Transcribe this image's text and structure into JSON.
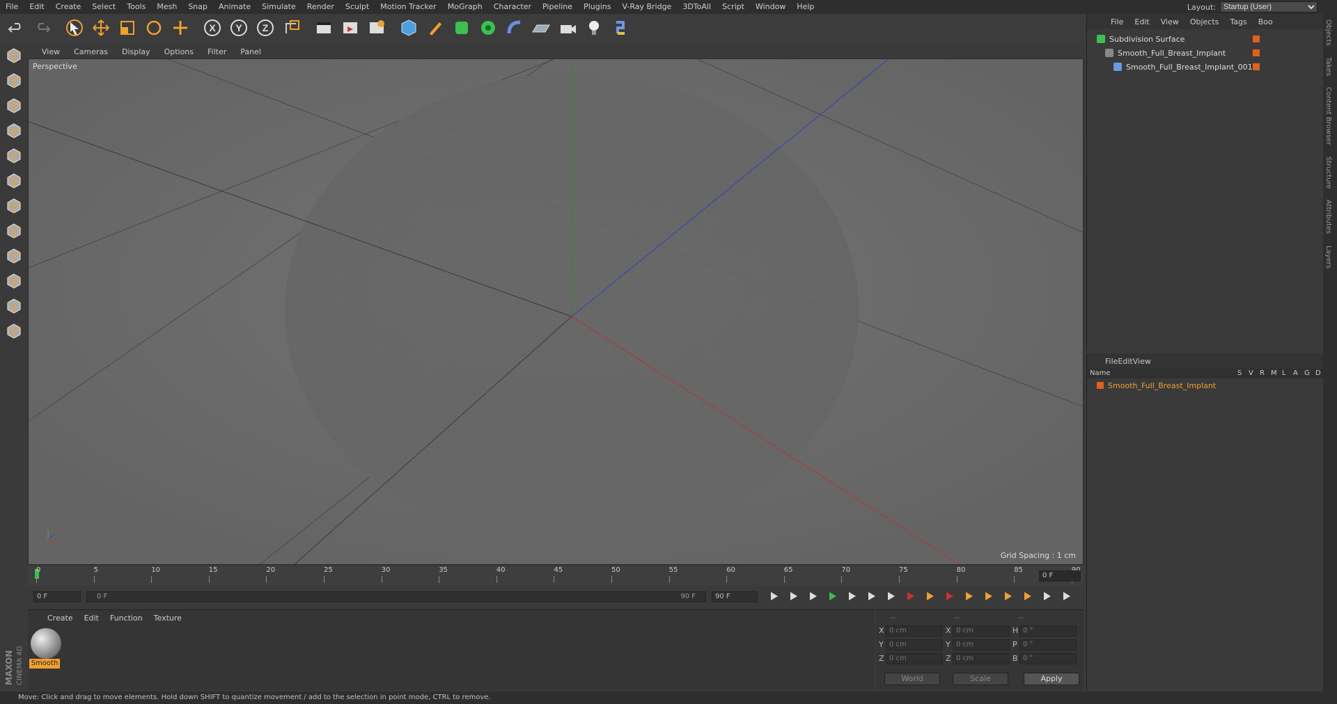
{
  "menu": [
    "File",
    "Edit",
    "Create",
    "Select",
    "Tools",
    "Mesh",
    "Snap",
    "Animate",
    "Simulate",
    "Render",
    "Sculpt",
    "Motion Tracker",
    "MoGraph",
    "Character",
    "Pipeline",
    "Plugins",
    "V-Ray Bridge",
    "3DToAll",
    "Script",
    "Window",
    "Help"
  ],
  "layout": {
    "label": "Layout:",
    "value": "Startup (User)"
  },
  "toolbar": {
    "tools": [
      "undo-icon",
      "redo-icon",
      "select-icon",
      "move-icon",
      "scale-icon",
      "rotate-icon",
      "transform-icon",
      "x-axis-icon",
      "y-axis-icon",
      "z-axis-icon",
      "world-coord-icon",
      "render-view-icon",
      "render-picture-icon",
      "render-settings-icon",
      "cube-icon",
      "pen-icon",
      "subdivision-icon",
      "array-icon",
      "deformer-icon",
      "floor-icon",
      "camera-icon",
      "light-icon",
      "python-icon"
    ],
    "axis_labels": [
      "X",
      "Y",
      "Z"
    ]
  },
  "viewport": {
    "menu": [
      "View",
      "Cameras",
      "Display",
      "Options",
      "Filter",
      "Panel"
    ],
    "label": "Perspective",
    "grid_spacing": "Grid Spacing : 1 cm"
  },
  "timeline": {
    "ticks": [
      "0",
      "5",
      "10",
      "15",
      "20",
      "25",
      "30",
      "35",
      "40",
      "45",
      "50",
      "55",
      "60",
      "65",
      "70",
      "75",
      "80",
      "85",
      "90"
    ],
    "current_frame": "0 F",
    "start_field": "0 F",
    "range_start": "0 F",
    "range_end": "90 F",
    "end_field": "90 F"
  },
  "material_panel": {
    "menu": [
      "Create",
      "Edit",
      "Function",
      "Texture"
    ],
    "material_name": "Smooth"
  },
  "coord_panel": {
    "headers": [
      "--",
      "--",
      "--"
    ],
    "rows": [
      {
        "a": "X",
        "av": "0 cm",
        "b": "X",
        "bv": "0 cm",
        "c": "H",
        "cv": "0 °"
      },
      {
        "a": "Y",
        "av": "0 cm",
        "b": "Y",
        "bv": "0 cm",
        "c": "P",
        "cv": "0 °"
      },
      {
        "a": "Z",
        "av": "0 cm",
        "b": "Z",
        "bv": "0 cm",
        "c": "B",
        "cv": "0 °"
      }
    ],
    "world": "World",
    "scale": "Scale",
    "apply": "Apply"
  },
  "object_manager": {
    "menu": [
      "File",
      "Edit",
      "View",
      "Objects",
      "Tags",
      "Boo"
    ],
    "objects": [
      "Subdivision Surface",
      "Smooth_Full_Breast_Implant",
      "Smooth_Full_Breast_Implant_001"
    ]
  },
  "layer_manager": {
    "menu": [
      "File",
      "Edit",
      "View"
    ],
    "columns": [
      "Name",
      "S",
      "V",
      "R",
      "M",
      "L",
      "A",
      "G",
      "D"
    ],
    "layer_name": "Smooth_Full_Breast_Implant"
  },
  "side_tabs": [
    "Objects",
    "Takes",
    "Content Browser",
    "Structure",
    "Attributes",
    "Layers"
  ],
  "status": "Move: Click and drag to move elements. Hold down SHIFT to quantize movement / add to the selection in point mode, CTRL to remove.",
  "brand": {
    "line1": "MAXON",
    "line2": "CINEMA 4D"
  },
  "colors": {
    "accent": "#f0a030",
    "x_axis": "#c03030",
    "y_axis": "#30a030",
    "z_axis": "#3040c0"
  }
}
